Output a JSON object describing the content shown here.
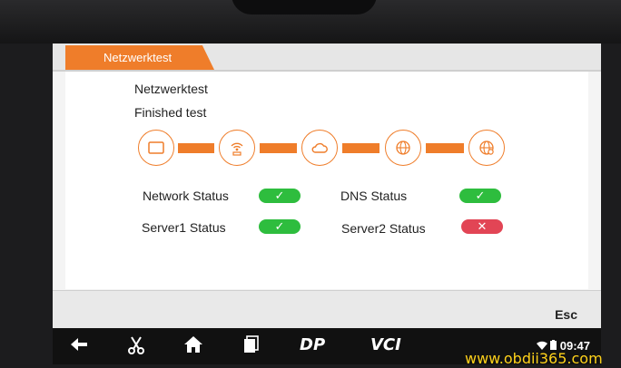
{
  "header": {
    "tab_label": "Netzwerktest"
  },
  "main": {
    "heading": "Netzwerktest",
    "status_text": "Finished test",
    "chain": [
      {
        "name": "device-icon"
      },
      {
        "name": "wifi-router-icon"
      },
      {
        "name": "cloud-icon"
      },
      {
        "name": "globe-icon"
      },
      {
        "name": "globe-gear-icon"
      }
    ],
    "statuses": [
      {
        "label": "Network Status",
        "state": "ok",
        "glyph": "✓"
      },
      {
        "label": "DNS Status",
        "state": "ok",
        "glyph": "✓"
      },
      {
        "label": "Server1 Status",
        "state": "ok",
        "glyph": "✓"
      },
      {
        "label": "Server2 Status",
        "state": "fail",
        "glyph": "✕"
      }
    ]
  },
  "footer": {
    "esc_label": "Esc"
  },
  "navbar": {
    "items": [
      "back-icon",
      "scissors-icon",
      "home-icon",
      "recent-apps-icon",
      "DP",
      "VCI"
    ],
    "dp_label": "DP",
    "vci_label": "VCI",
    "time": "09:47"
  },
  "watermark": "www.obdii365.com",
  "colors": {
    "accent": "#ef7d2a",
    "ok": "#2ebd3e",
    "fail": "#e24555"
  }
}
